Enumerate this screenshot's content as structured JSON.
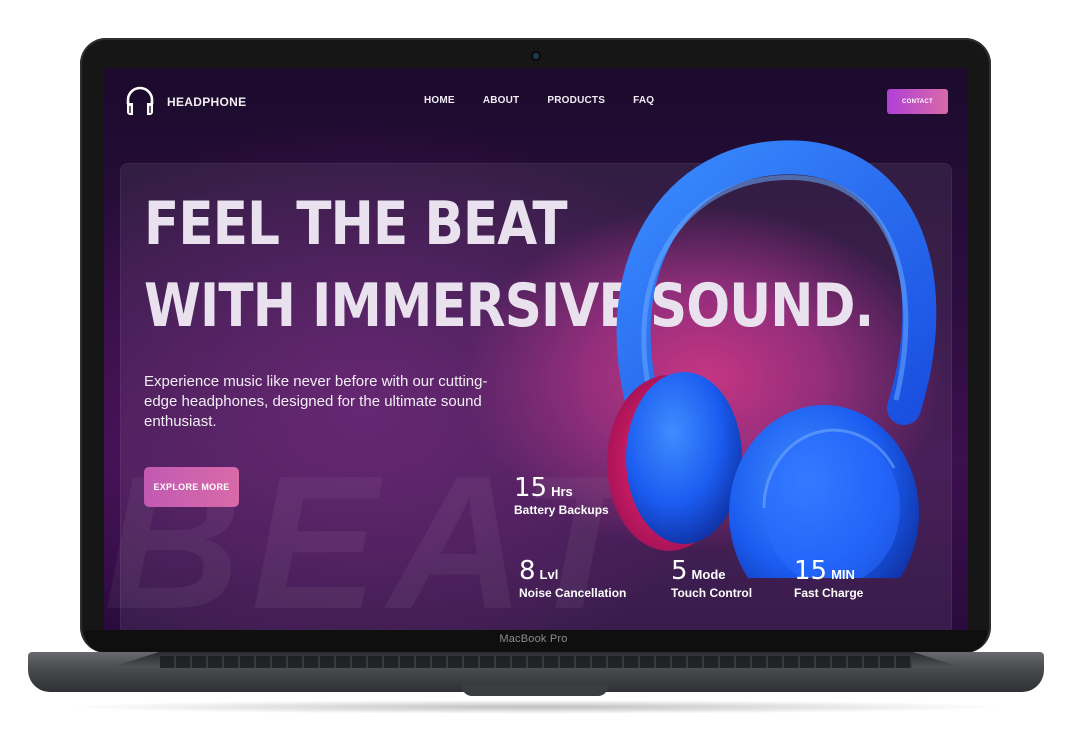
{
  "device": {
    "label": "MacBook Pro"
  },
  "nav": {
    "brand": "HEADPHONE",
    "logo_icon": "headphone-icon",
    "links": [
      "HOME",
      "ABOUT",
      "PRODUCTS",
      "FAQ"
    ],
    "contact_label": "CONTACT"
  },
  "hero": {
    "title_line1": "FEEL THE BEAT",
    "title_line2": "WITH IMMERSIVE SOUND.",
    "subtitle": "Experience music like never before with our cutting-edge headphones, designed for the ultimate sound enthusiast.",
    "cta_label": "EXPLORE MORE",
    "background_word": "BEAT"
  },
  "stats": [
    {
      "value": "15",
      "unit": "Hrs",
      "label": "Battery Backups"
    },
    {
      "value": "8",
      "unit": "Lvl",
      "label": "Noise Cancellation"
    },
    {
      "value": "5",
      "unit": "Mode",
      "label": "Touch Control"
    },
    {
      "value": "15",
      "unit": "MIN",
      "label": "Fast Charge"
    }
  ],
  "colors": {
    "background_dark": "#1b0b2c",
    "accent_pink": "#d86aa8",
    "accent_purple": "#b03fd6",
    "headphone_blue": "#1f6bff"
  }
}
